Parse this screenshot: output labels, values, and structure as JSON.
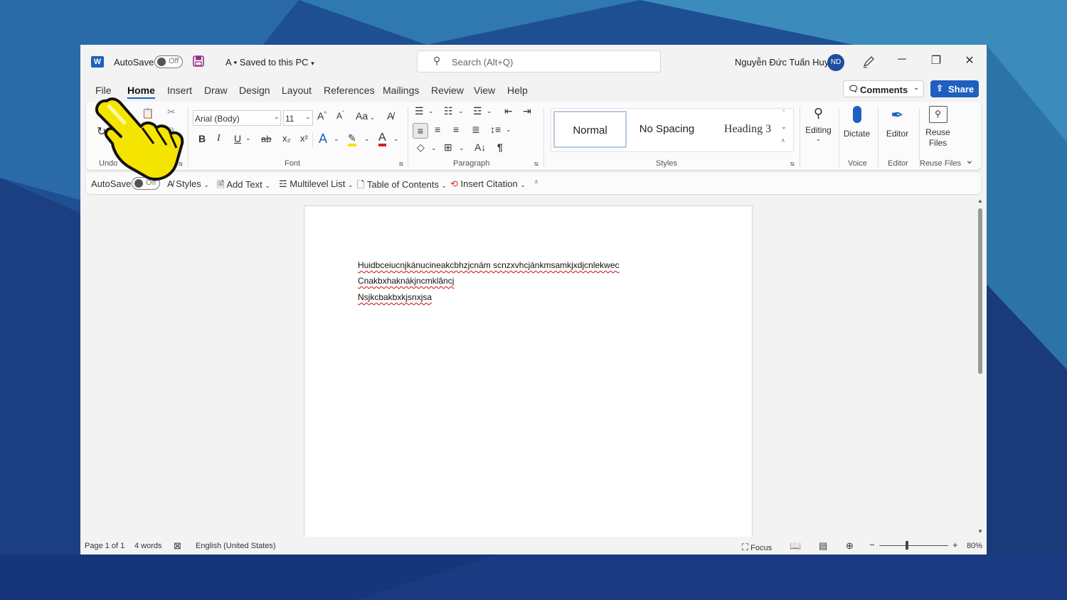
{
  "title_bar": {
    "app_icon": "W",
    "autosave_label": "AutoSave",
    "autosave_state": "Off",
    "document_status": "A • Saved to this PC",
    "search_placeholder": "Search (Alt+Q)",
    "user_name": "Nguyễn Đức Tuấn Huy",
    "user_initials": "ND",
    "minimize": "─",
    "restore": "❐",
    "close": "✕"
  },
  "menu": {
    "items": [
      "File",
      "Home",
      "Insert",
      "Draw",
      "Design",
      "Layout",
      "References",
      "Mailings",
      "Review",
      "View",
      "Help"
    ],
    "active": "Home",
    "comments_label": "Comments",
    "share_label": "Share"
  },
  "ribbon": {
    "undo_group": "Undo",
    "font_group": "Font",
    "paragraph_group": "Paragraph",
    "styles_group": "Styles",
    "voice_group": "Voice",
    "editor_group": "Editor",
    "reuse_group": "Reuse Files",
    "font_name": "Arial (Body)",
    "font_size": "11",
    "change_case": "Aa",
    "bold": "B",
    "italic": "I",
    "underline": "U",
    "strike": "ab",
    "subscript": "x₂",
    "superscript": "x²",
    "styles": [
      "Normal",
      "No Spacing",
      "Heading 3"
    ],
    "editing_label": "Editing",
    "dictate_label": "Dictate",
    "editor_label": "Editor",
    "reuse_label_1": "Reuse",
    "reuse_label_2": "Files"
  },
  "quick_access": {
    "autosave_label": "AutoSave",
    "autosave_state": "Off",
    "styles": "Styles",
    "add_text": "Add Text",
    "multilevel_list": "Multilevel List",
    "table_of_contents": "Table of Contents",
    "insert_citation": "Insert Citation"
  },
  "document": {
    "lines": [
      "Huidbceiucnjkánucineakcbhzjcnám scnzxvhcjánkmsamkjxdjcnlekwec",
      "Cnakbxhaknákjncmklâncj",
      "Nsjkcbakbxkjsnxjsa"
    ]
  },
  "status_bar": {
    "page": "Page 1 of 1",
    "words": "4 words",
    "language": "English (United States)",
    "focus": "Focus",
    "zoom_minus": "−",
    "zoom_plus": "+",
    "zoom": "80%"
  },
  "colors": {
    "accent": "#1f5fbf",
    "background": "#1d4a8a",
    "hand_pointer": "#f5e400"
  }
}
